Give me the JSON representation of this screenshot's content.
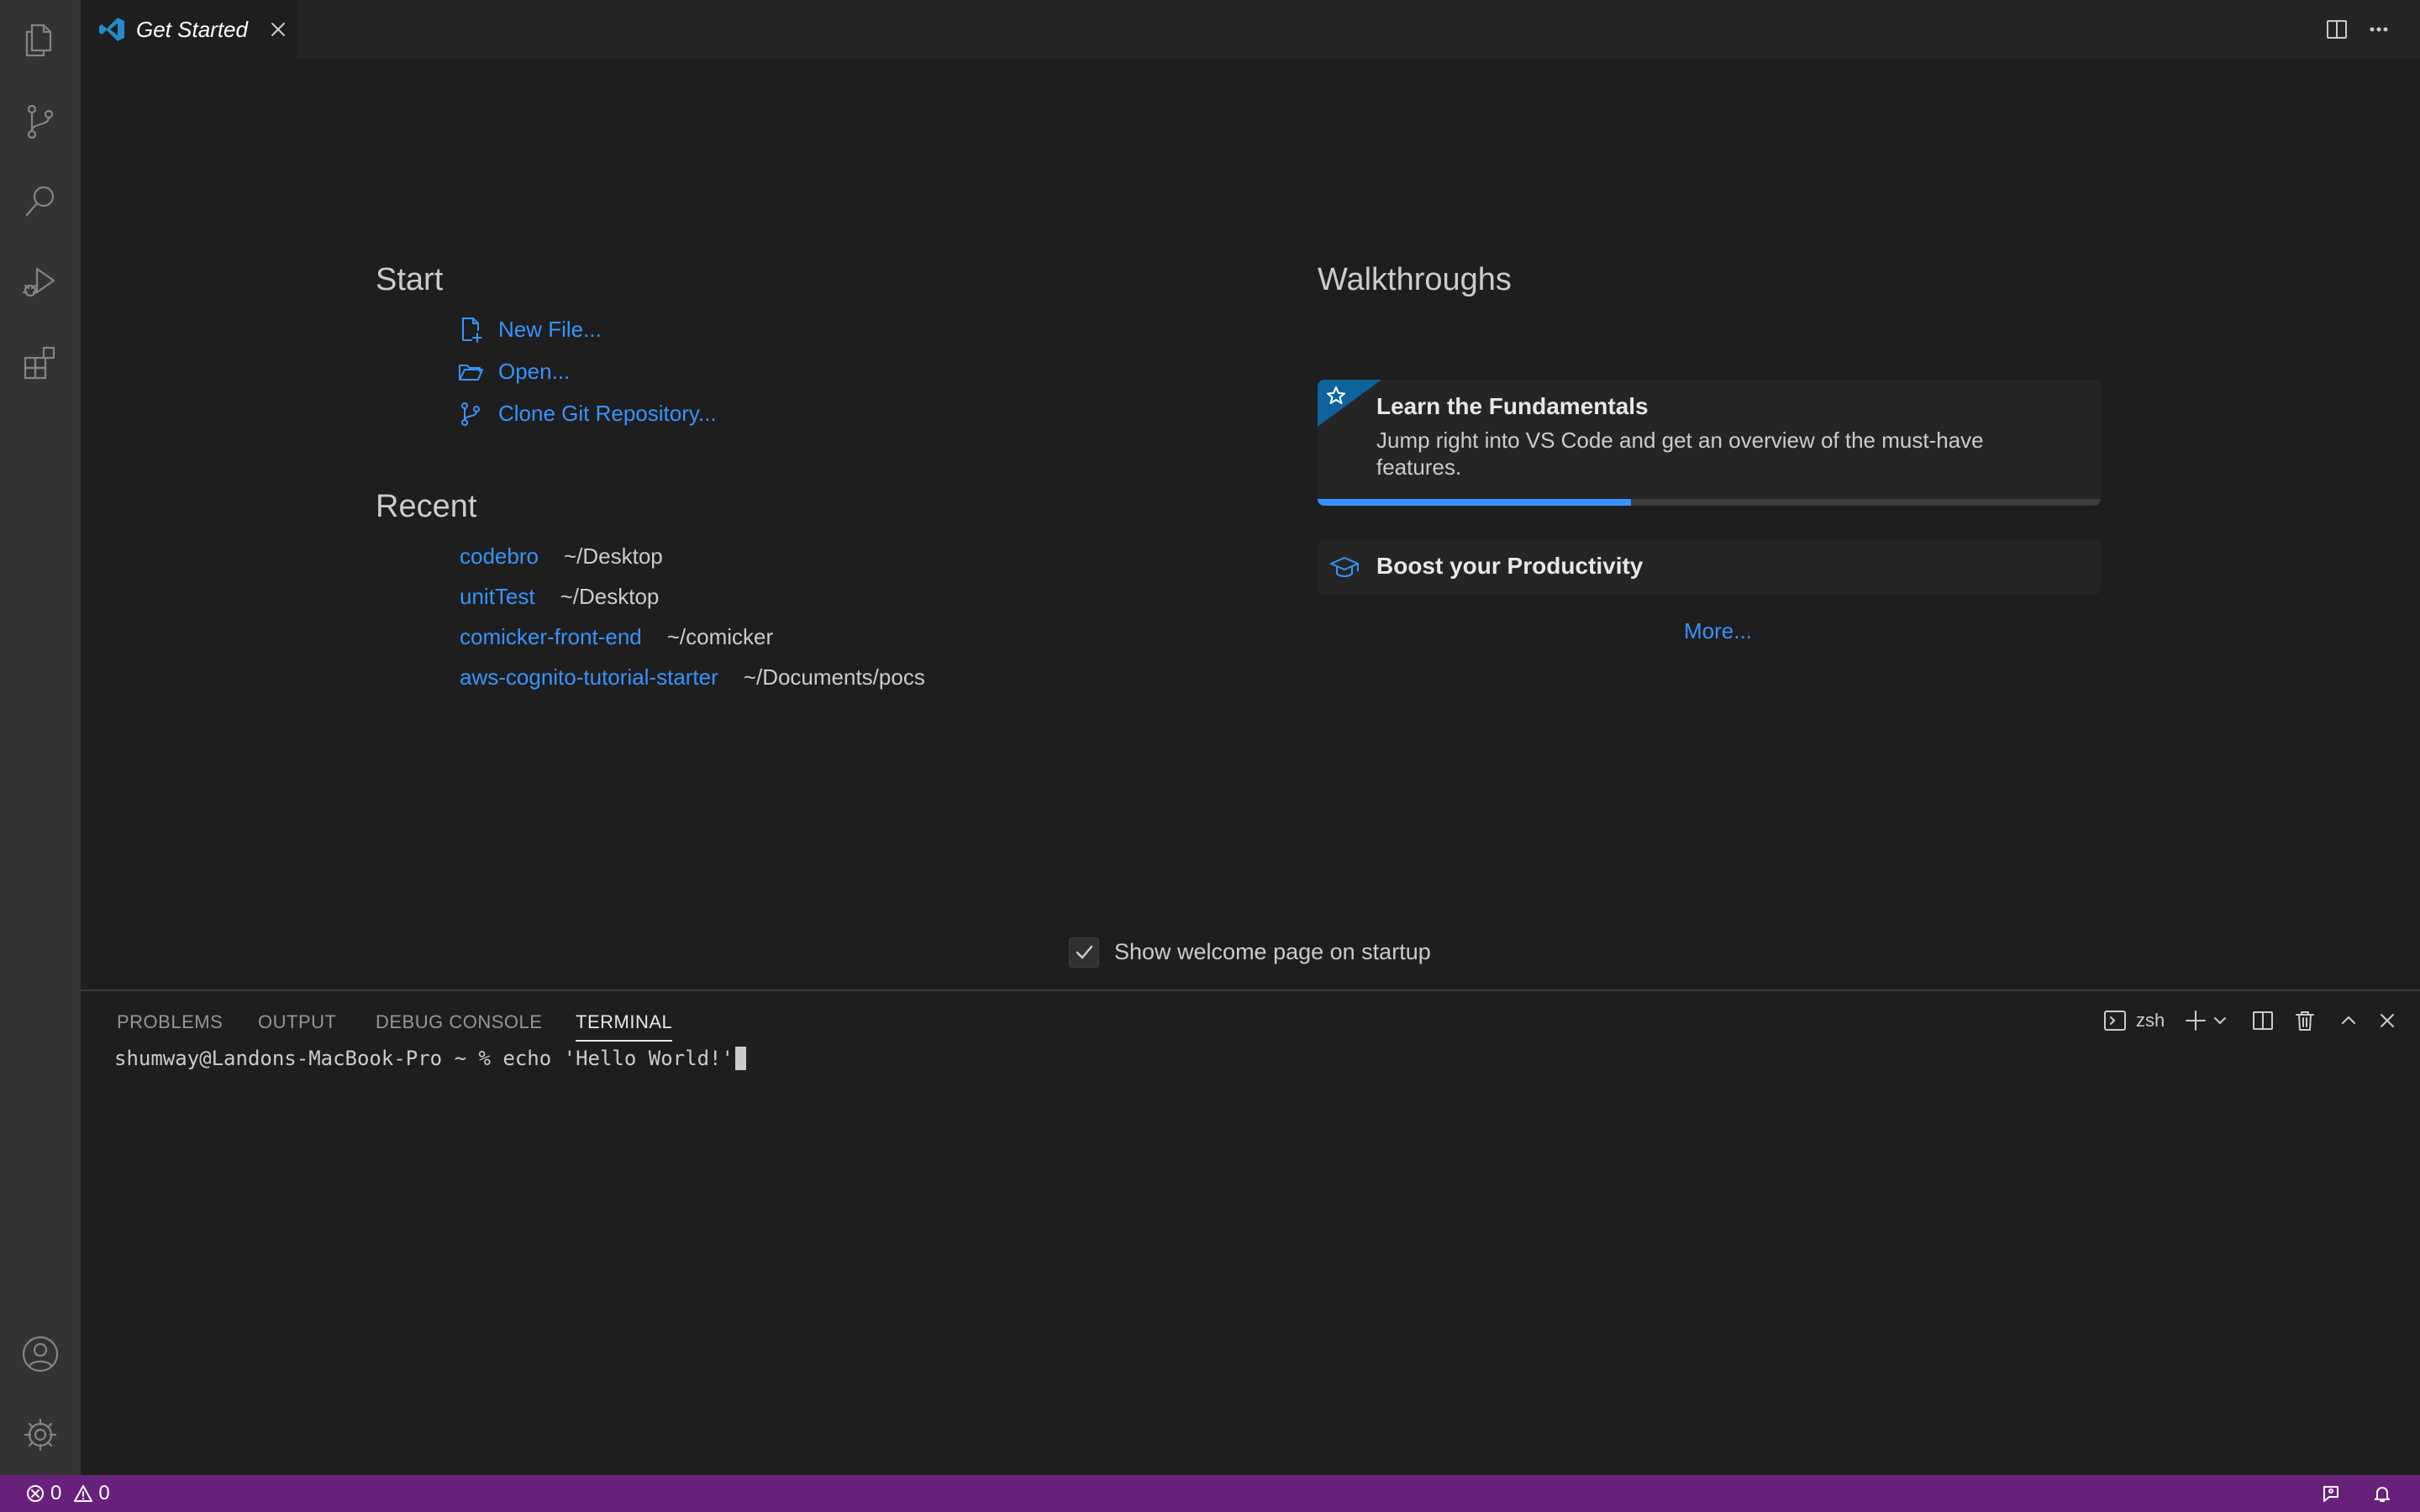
{
  "tab": {
    "title": "Get Started"
  },
  "activity_bar": {
    "items": [
      "files-icon",
      "source-control-icon",
      "search-icon",
      "run-debug-icon",
      "extensions-icon"
    ],
    "bottom": [
      "account-icon",
      "manage-gear-icon"
    ]
  },
  "start": {
    "heading": "Start",
    "items": [
      {
        "label": "New File...",
        "icon": "new-file-icon"
      },
      {
        "label": "Open...",
        "icon": "open-folder-icon"
      },
      {
        "label": "Clone Git Repository...",
        "icon": "git-clone-icon"
      }
    ]
  },
  "recent": {
    "heading": "Recent",
    "items": [
      {
        "name": "codebro",
        "path": "~/Desktop"
      },
      {
        "name": "unitTest",
        "path": "~/Desktop"
      },
      {
        "name": "comicker-front-end",
        "path": "~/comicker"
      },
      {
        "name": "aws-cognito-tutorial-starter",
        "path": "~/Documents/pocs"
      }
    ]
  },
  "walkthroughs": {
    "heading": "Walkthroughs",
    "fundamentals": {
      "title": "Learn the Fundamentals",
      "description": "Jump right into VS Code and get an overview of the must-have features.",
      "progress": 0.4
    },
    "productivity": {
      "title": "Boost your Productivity"
    },
    "more": "More..."
  },
  "startup": {
    "label": "Show welcome page on startup",
    "checked": true
  },
  "panel": {
    "tabs": [
      "PROBLEMS",
      "OUTPUT",
      "DEBUG CONSOLE",
      "TERMINAL"
    ],
    "active_tab": "TERMINAL",
    "shell": "zsh",
    "terminal_line": "shumway@Landons-MacBook-Pro ~ % echo 'Hello World!'"
  },
  "status_bar": {
    "errors": "0",
    "warnings": "0"
  },
  "colors": {
    "accent": "#3794ff",
    "status_bar": "#68217a",
    "walkthrough_badge": "#0e639c"
  }
}
